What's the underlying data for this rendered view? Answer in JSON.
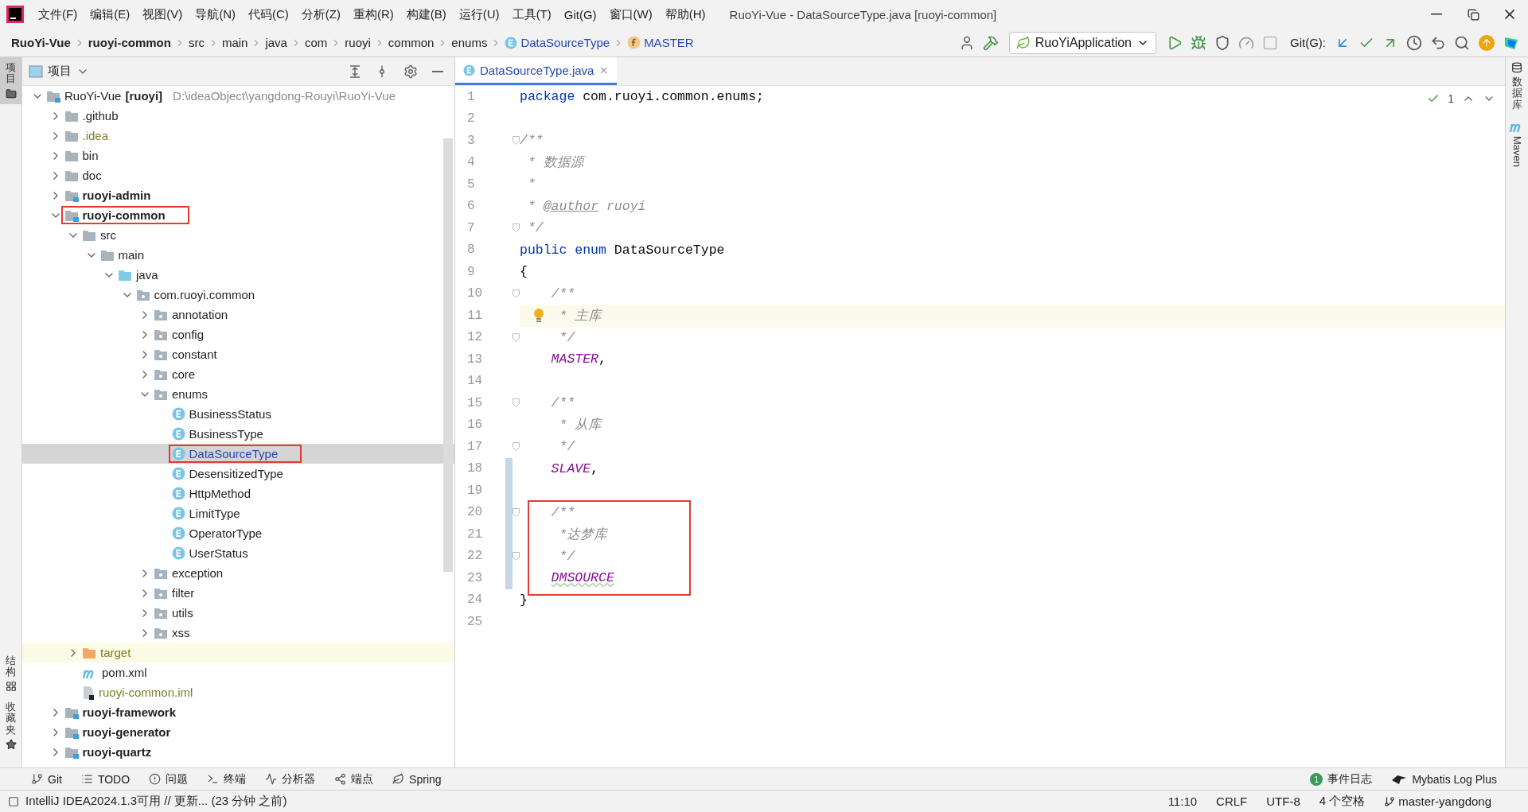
{
  "window": {
    "title": "RuoYi-Vue - DataSourceType.java [ruoyi-common]"
  },
  "menu": [
    "文件(F)",
    "编辑(E)",
    "视图(V)",
    "导航(N)",
    "代码(C)",
    "分析(Z)",
    "重构(R)",
    "构建(B)",
    "运行(U)",
    "工具(T)",
    "Git(G)",
    "窗口(W)",
    "帮助(H)"
  ],
  "breadcrumbs": [
    {
      "label": "RuoYi-Vue",
      "kind": "project"
    },
    {
      "label": "ruoyi-common",
      "kind": "module"
    },
    {
      "label": "src",
      "kind": "dir"
    },
    {
      "label": "main",
      "kind": "dir"
    },
    {
      "label": "java",
      "kind": "dir"
    },
    {
      "label": "com",
      "kind": "dir"
    },
    {
      "label": "ruoyi",
      "kind": "dir"
    },
    {
      "label": "common",
      "kind": "dir"
    },
    {
      "label": "enums",
      "kind": "dir"
    },
    {
      "label": "DataSourceType",
      "kind": "enum"
    },
    {
      "label": "MASTER",
      "kind": "field"
    }
  ],
  "toolbar": [
    {
      "kind": "user",
      "disabled": false
    },
    {
      "kind": "build",
      "disabled": false
    },
    {
      "kind": "config",
      "label": "RuoYiApplication"
    },
    {
      "kind": "run",
      "disabled": false
    },
    {
      "kind": "debug",
      "disabled": false
    },
    {
      "kind": "coverage",
      "disabled": false
    },
    {
      "kind": "profile",
      "disabled": false
    },
    {
      "kind": "stop",
      "disabled": true
    },
    {
      "kind": "label",
      "label": "Git(G):"
    },
    {
      "kind": "update",
      "disabled": false
    },
    {
      "kind": "commit",
      "disabled": false
    },
    {
      "kind": "push",
      "disabled": false
    },
    {
      "kind": "history",
      "disabled": false
    },
    {
      "kind": "rollback",
      "disabled": false
    },
    {
      "kind": "search",
      "disabled": false
    },
    {
      "kind": "upgrade",
      "disabled": false
    },
    {
      "kind": "toolbox"
    }
  ],
  "left_stripe": [
    {
      "label": "项目",
      "kind": "project",
      "selected": true
    },
    {
      "label": "结构",
      "kind": "structure",
      "selected": false
    },
    {
      "label": "收藏夹",
      "kind": "favorites",
      "selected": false
    }
  ],
  "project_panel": {
    "title": "项目",
    "tree": [
      {
        "label": "RuoYi-Vue",
        "suffix": "[ruoyi]",
        "path": "D:\\ideaObject\\yangdong-Rouyi\\RuoYi-Vue",
        "kind": "project-root",
        "expanded": true,
        "selected": false,
        "boxed": false,
        "children": [
          {
            "label": ".github",
            "kind": "folder",
            "expanded": false,
            "selected": false,
            "boxed": false
          },
          {
            "label": ".idea",
            "kind": "ignored-folder",
            "expanded": false,
            "selected": false,
            "boxed": false
          },
          {
            "label": "bin",
            "kind": "folder",
            "expanded": false,
            "selected": false,
            "boxed": false
          },
          {
            "label": "doc",
            "kind": "folder",
            "expanded": false,
            "selected": false,
            "boxed": false
          },
          {
            "label": "ruoyi-admin",
            "kind": "module",
            "expanded": false,
            "selected": false,
            "boxed": false
          },
          {
            "label": "ruoyi-common",
            "kind": "module",
            "expanded": true,
            "selected": false,
            "boxed": true,
            "children": [
              {
                "label": "src",
                "kind": "folder",
                "expanded": true,
                "selected": false,
                "boxed": false,
                "children": [
                  {
                    "label": "main",
                    "kind": "folder",
                    "expanded": true,
                    "selected": false,
                    "boxed": false,
                    "children": [
                      {
                        "label": "java",
                        "kind": "source-root",
                        "expanded": true,
                        "selected": false,
                        "boxed": false,
                        "children": [
                          {
                            "label": "com.ruoyi.common",
                            "kind": "package",
                            "expanded": true,
                            "selected": false,
                            "boxed": false,
                            "children": [
                              {
                                "label": "annotation",
                                "kind": "package",
                                "expanded": false,
                                "selected": false,
                                "boxed": false
                              },
                              {
                                "label": "config",
                                "kind": "package",
                                "expanded": false,
                                "selected": false,
                                "boxed": false
                              },
                              {
                                "label": "constant",
                                "kind": "package",
                                "expanded": false,
                                "selected": false,
                                "boxed": false
                              },
                              {
                                "label": "core",
                                "kind": "package",
                                "expanded": false,
                                "selected": false,
                                "boxed": false
                              },
                              {
                                "label": "enums",
                                "kind": "package",
                                "expanded": true,
                                "selected": false,
                                "boxed": false,
                                "children": [
                                  {
                                    "label": "BusinessStatus",
                                    "kind": "enum",
                                    "selected": false,
                                    "boxed": false
                                  },
                                  {
                                    "label": "BusinessType",
                                    "kind": "enum",
                                    "selected": false,
                                    "boxed": false
                                  },
                                  {
                                    "label": "DataSourceType",
                                    "kind": "enum",
                                    "selected": true,
                                    "boxed": true
                                  },
                                  {
                                    "label": "DesensitizedType",
                                    "kind": "enum",
                                    "selected": false,
                                    "boxed": false
                                  },
                                  {
                                    "label": "HttpMethod",
                                    "kind": "enum",
                                    "selected": false,
                                    "boxed": false
                                  },
                                  {
                                    "label": "LimitType",
                                    "kind": "enum",
                                    "selected": false,
                                    "boxed": false
                                  },
                                  {
                                    "label": "OperatorType",
                                    "kind": "enum",
                                    "selected": false,
                                    "boxed": false
                                  },
                                  {
                                    "label": "UserStatus",
                                    "kind": "enum",
                                    "selected": false,
                                    "boxed": false
                                  }
                                ]
                              },
                              {
                                "label": "exception",
                                "kind": "package",
                                "expanded": false,
                                "selected": false,
                                "boxed": false
                              },
                              {
                                "label": "filter",
                                "kind": "package",
                                "expanded": false,
                                "selected": false,
                                "boxed": false
                              },
                              {
                                "label": "utils",
                                "kind": "package",
                                "expanded": false,
                                "selected": false,
                                "boxed": false
                              },
                              {
                                "label": "xss",
                                "kind": "package",
                                "expanded": false,
                                "selected": false,
                                "boxed": false
                              }
                            ]
                          }
                        ]
                      }
                    ]
                  }
                ]
              },
              {
                "label": "target",
                "kind": "excluded-folder",
                "expanded": false,
                "selected": false,
                "boxed": false
              },
              {
                "label": "pom.xml",
                "kind": "maven",
                "selected": false,
                "boxed": false
              },
              {
                "label": "ruoyi-common.iml",
                "kind": "ignored-file",
                "selected": false,
                "boxed": false
              }
            ]
          },
          {
            "label": "ruoyi-framework",
            "kind": "module",
            "expanded": false,
            "selected": false,
            "boxed": false
          },
          {
            "label": "ruoyi-generator",
            "kind": "module",
            "expanded": false,
            "selected": false,
            "boxed": false
          },
          {
            "label": "ruoyi-quartz",
            "kind": "module",
            "expanded": false,
            "selected": false,
            "boxed": false
          }
        ]
      }
    ]
  },
  "editor": {
    "tabs": [
      {
        "label": "DataSourceType.java",
        "selected": true
      }
    ],
    "inspection": "1",
    "lines": [
      {
        "n": "1",
        "fold": false,
        "current": false,
        "changed": false,
        "boxed": false,
        "intention": false,
        "tokens": [
          {
            "kind": "keyword",
            "text": "package"
          },
          {
            "kind": "plain",
            "text": " com.ruoyi.common.enums;"
          }
        ]
      },
      {
        "n": "2",
        "fold": false,
        "current": false,
        "changed": false,
        "boxed": false,
        "intention": false
      },
      {
        "n": "3",
        "fold": true,
        "current": false,
        "changed": false,
        "boxed": false,
        "intention": false,
        "tokens": [
          {
            "kind": "comment",
            "text": "/**"
          }
        ]
      },
      {
        "n": "4",
        "fold": false,
        "current": false,
        "changed": false,
        "boxed": false,
        "intention": false,
        "tokens": [
          {
            "kind": "comment",
            "text": " * 数据源"
          }
        ]
      },
      {
        "n": "5",
        "fold": false,
        "current": false,
        "changed": false,
        "boxed": false,
        "intention": false,
        "tokens": [
          {
            "kind": "comment",
            "text": " *"
          }
        ]
      },
      {
        "n": "6",
        "fold": false,
        "current": false,
        "changed": false,
        "boxed": false,
        "intention": false,
        "tokens": [
          {
            "kind": "comment",
            "text": " * "
          },
          {
            "kind": "doc-tag",
            "text": "@author"
          },
          {
            "kind": "comment",
            "text": " ruoyi"
          }
        ]
      },
      {
        "n": "7",
        "fold": true,
        "current": false,
        "changed": false,
        "boxed": false,
        "intention": false,
        "tokens": [
          {
            "kind": "comment",
            "text": " */"
          }
        ]
      },
      {
        "n": "8",
        "fold": false,
        "current": false,
        "changed": false,
        "boxed": false,
        "intention": false,
        "tokens": [
          {
            "kind": "keyword",
            "text": "public enum"
          },
          {
            "kind": "plain",
            "text": " DataSourceType"
          }
        ]
      },
      {
        "n": "9",
        "fold": false,
        "current": false,
        "changed": false,
        "boxed": false,
        "intention": false,
        "tokens": [
          {
            "kind": "plain",
            "text": "{"
          }
        ]
      },
      {
        "n": "10",
        "fold": true,
        "current": false,
        "changed": false,
        "boxed": false,
        "intention": false,
        "tokens": [
          {
            "kind": "comment",
            "text": "    /**"
          }
        ]
      },
      {
        "n": "11",
        "fold": false,
        "current": true,
        "changed": false,
        "boxed": false,
        "intention": true,
        "tokens": [
          {
            "kind": "comment",
            "text": "     * 主库"
          }
        ]
      },
      {
        "n": "12",
        "fold": true,
        "current": false,
        "changed": false,
        "boxed": false,
        "intention": false,
        "tokens": [
          {
            "kind": "comment",
            "text": "     */"
          }
        ]
      },
      {
        "n": "13",
        "fold": false,
        "current": false,
        "changed": false,
        "boxed": false,
        "intention": false,
        "tokens": [
          {
            "kind": "constant",
            "text": "    MASTER"
          },
          {
            "kind": "plain",
            "text": ","
          }
        ]
      },
      {
        "n": "14",
        "fold": false,
        "current": false,
        "changed": false,
        "boxed": false,
        "intention": false
      },
      {
        "n": "15",
        "fold": true,
        "current": false,
        "changed": false,
        "boxed": false,
        "intention": false,
        "tokens": [
          {
            "kind": "comment",
            "text": "    /**"
          }
        ]
      },
      {
        "n": "16",
        "fold": false,
        "current": false,
        "changed": false,
        "boxed": false,
        "intention": false,
        "tokens": [
          {
            "kind": "comment",
            "text": "     * 从库"
          }
        ]
      },
      {
        "n": "17",
        "fold": true,
        "current": false,
        "changed": false,
        "boxed": false,
        "intention": false,
        "tokens": [
          {
            "kind": "comment",
            "text": "     */"
          }
        ]
      },
      {
        "n": "18",
        "fold": false,
        "current": false,
        "changed": true,
        "boxed": false,
        "intention": false,
        "tokens": [
          {
            "kind": "constant",
            "text": "    SLAVE"
          },
          {
            "kind": "plain",
            "text": ","
          }
        ]
      },
      {
        "n": "19",
        "fold": false,
        "current": false,
        "changed": true,
        "boxed": false,
        "intention": false
      },
      {
        "n": "20",
        "fold": true,
        "current": false,
        "changed": true,
        "boxed": true,
        "intention": false,
        "tokens": [
          {
            "kind": "comment",
            "text": "    /**"
          }
        ]
      },
      {
        "n": "21",
        "fold": false,
        "current": false,
        "changed": true,
        "boxed": true,
        "intention": false,
        "tokens": [
          {
            "kind": "comment",
            "text": "     *达梦库"
          }
        ]
      },
      {
        "n": "22",
        "fold": true,
        "current": false,
        "changed": true,
        "boxed": true,
        "intention": false,
        "tokens": [
          {
            "kind": "comment",
            "text": "     */"
          }
        ]
      },
      {
        "n": "23",
        "fold": false,
        "current": false,
        "changed": true,
        "boxed": true,
        "intention": false,
        "tokens": [
          {
            "kind": "constant-warning",
            "text": "    DMSOURCE"
          }
        ]
      },
      {
        "n": "24",
        "fold": false,
        "current": false,
        "changed": false,
        "boxed": false,
        "intention": false,
        "tokens": [
          {
            "kind": "plain",
            "text": "}"
          }
        ]
      },
      {
        "n": "25",
        "fold": false,
        "current": false,
        "changed": false,
        "boxed": false,
        "intention": false
      }
    ]
  },
  "right_stripe": [
    {
      "label": "数据库",
      "kind": "database"
    },
    {
      "label": "Maven",
      "kind": "maven"
    }
  ],
  "tool_windows": {
    "left": [
      {
        "label": "Git",
        "kind": "git"
      },
      {
        "label": "TODO",
        "kind": "todo"
      },
      {
        "label": "问题",
        "kind": "problems"
      },
      {
        "label": "终端",
        "kind": "terminal"
      },
      {
        "label": "分析器",
        "kind": "profiler"
      },
      {
        "label": "端点",
        "kind": "endpoints"
      },
      {
        "label": "Spring",
        "kind": "spring"
      }
    ],
    "right": [
      {
        "label": "事件日志",
        "kind": "events",
        "badge": "1"
      },
      {
        "label": "Mybatis Log Plus",
        "kind": "mybatis"
      }
    ]
  },
  "status_bar": {
    "message": "IntelliJ IDEA2024.1.3可用 // 更新... (23 分钟 之前)",
    "items": [
      {
        "label": "11:10",
        "kind": "text"
      },
      {
        "label": "CRLF",
        "kind": "text"
      },
      {
        "label": "UTF-8",
        "kind": "text"
      },
      {
        "label": "4 个空格",
        "kind": "text"
      },
      {
        "label": "master-yangdong",
        "kind": "branch"
      }
    ]
  }
}
